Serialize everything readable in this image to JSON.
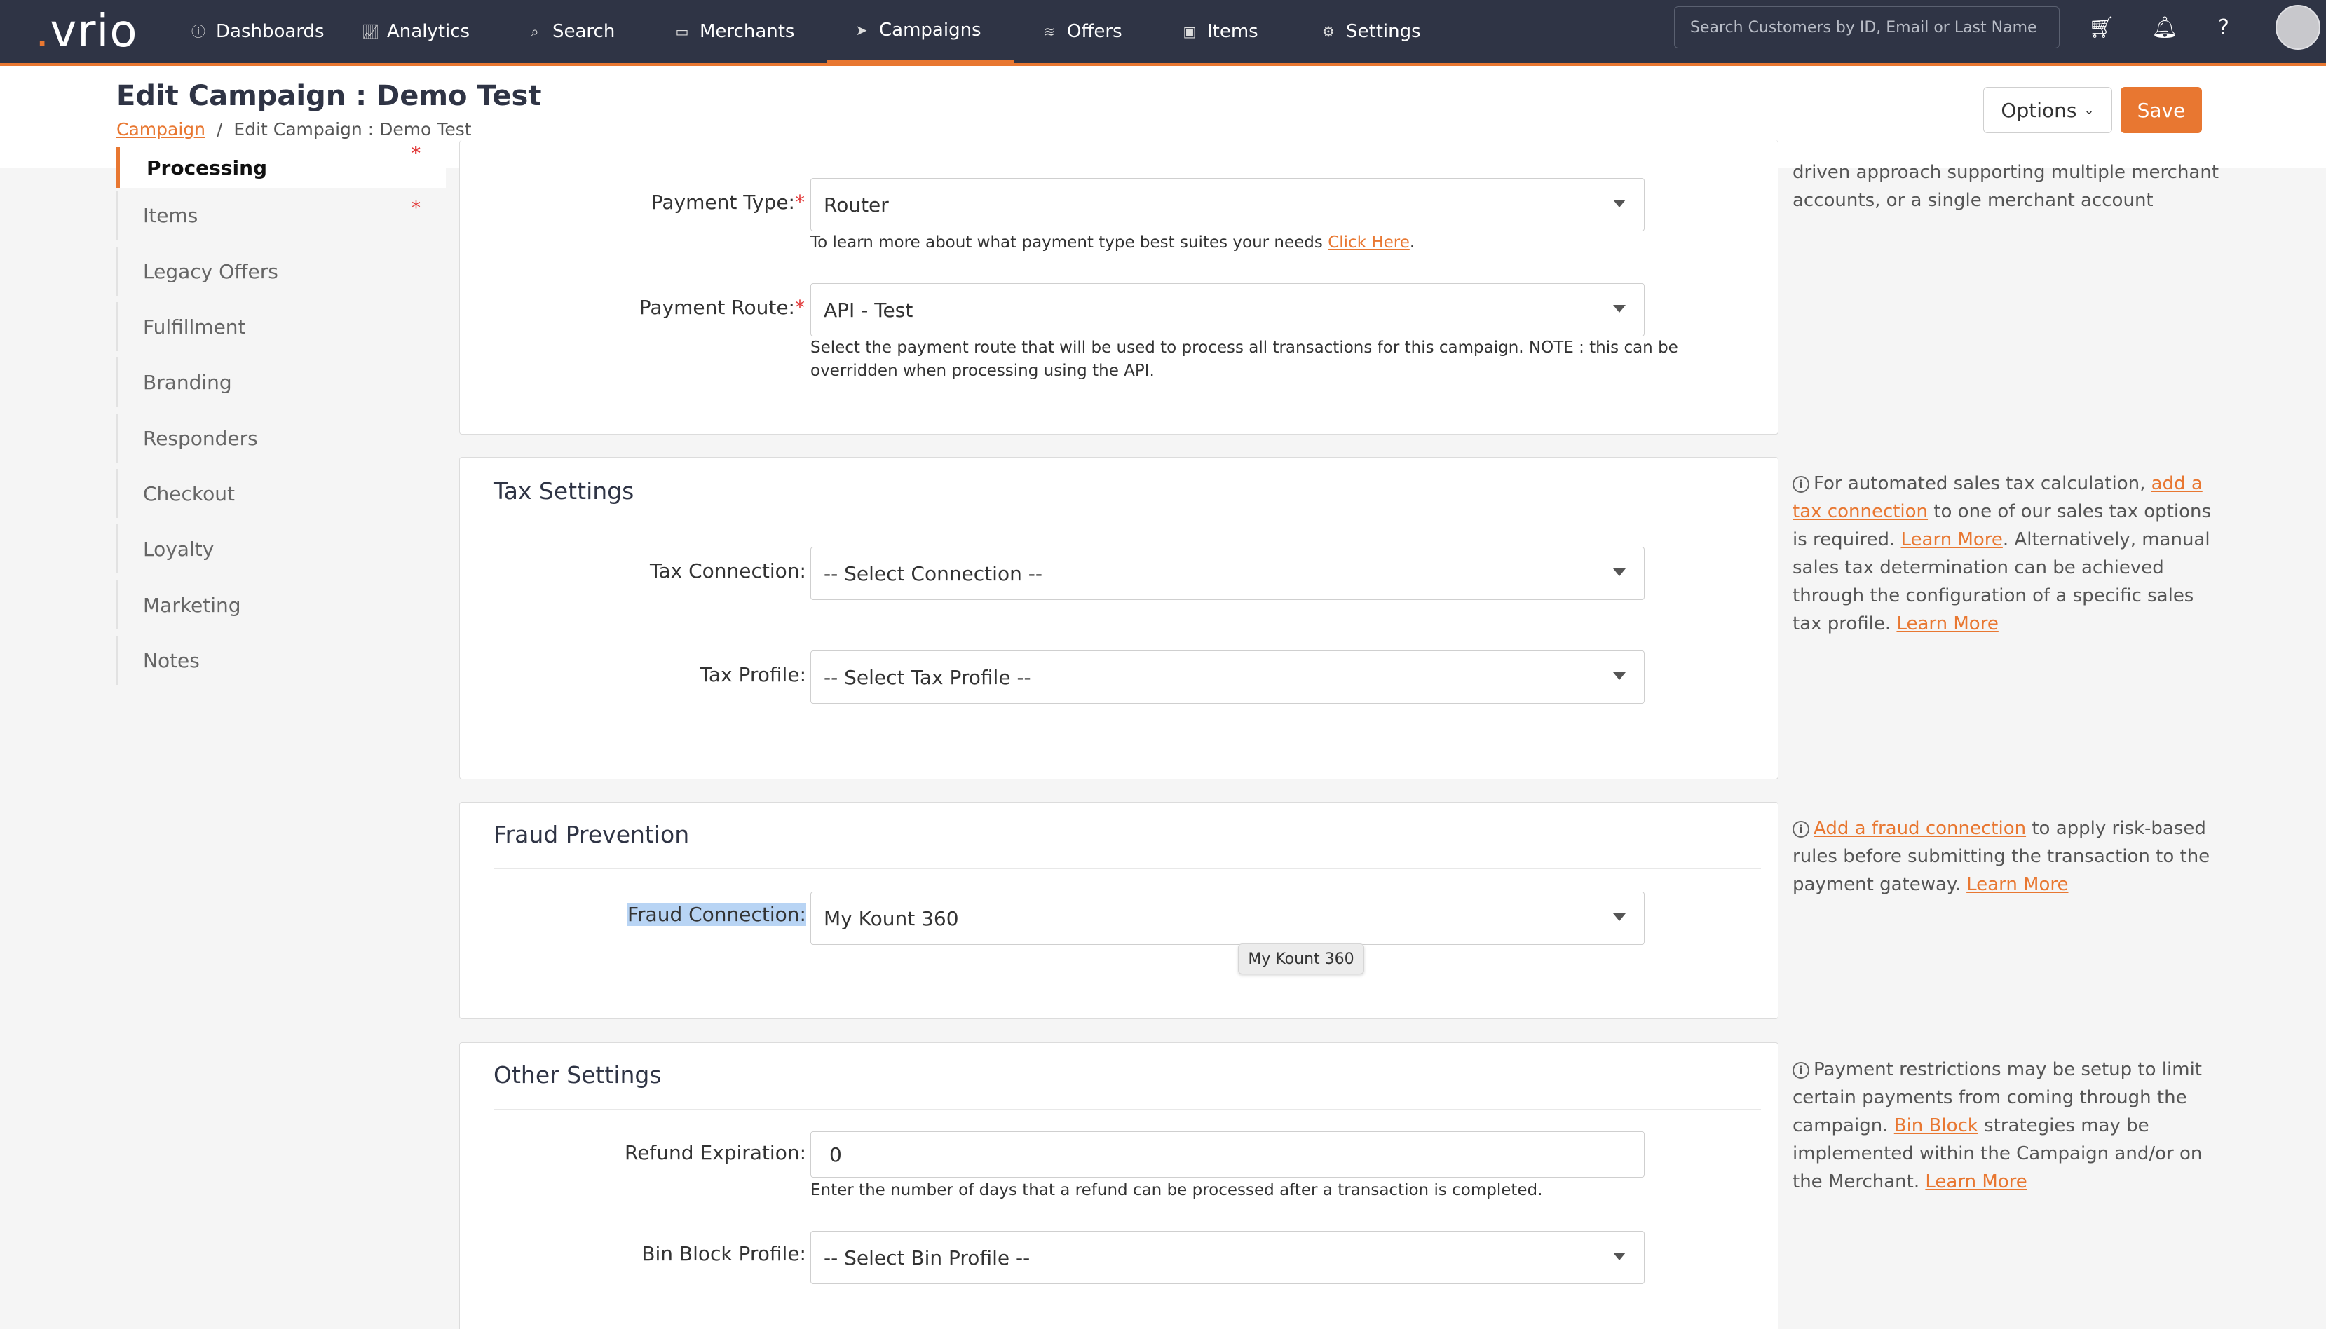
{
  "brand": {
    "logo": "vrio",
    "accent": "#e87731",
    "nav_bg": "#2f3445"
  },
  "nav": {
    "items": [
      {
        "label": "Dashboards",
        "icon": "info-circle-icon"
      },
      {
        "label": "Analytics",
        "icon": "chart-line-icon"
      },
      {
        "label": "Search",
        "icon": "search-icon"
      },
      {
        "label": "Merchants",
        "icon": "credit-card-icon"
      },
      {
        "label": "Campaigns",
        "icon": "paper-plane-icon",
        "active": true
      },
      {
        "label": "Offers",
        "icon": "layers-icon"
      },
      {
        "label": "Items",
        "icon": "box-icon"
      },
      {
        "label": "Settings",
        "icon": "gears-icon"
      }
    ],
    "search_placeholder": "Search Customers by ID, Email or Last Name"
  },
  "header": {
    "title": "Edit Campaign : Demo Test",
    "breadcrumb": {
      "link": "Campaign",
      "current": "Edit Campaign : Demo Test"
    },
    "options_label": "Options",
    "save_label": "Save"
  },
  "sidebar": {
    "items": [
      {
        "label": "Processing",
        "active": true,
        "required": true
      },
      {
        "label": "Items",
        "required": true
      },
      {
        "label": "Legacy Offers"
      },
      {
        "label": "Fulfillment"
      },
      {
        "label": "Branding"
      },
      {
        "label": "Responders"
      },
      {
        "label": "Checkout"
      },
      {
        "label": "Loyalty"
      },
      {
        "label": "Marketing"
      },
      {
        "label": "Notes"
      }
    ]
  },
  "processing": {
    "payment_type_label": "Payment Type:",
    "payment_type_value": "Router",
    "payment_type_help": "To learn more about what payment type best suites your needs ",
    "payment_type_help_link": "Click Here",
    "payment_route_label": "Payment Route:",
    "payment_route_value": "API - Test",
    "payment_route_help": "Select the payment route that will be used to process all transactions for this campaign. NOTE : this can be overridden when processing using the API.",
    "info_text": "driven approach supporting multiple merchant accounts, or a single merchant account option."
  },
  "tax": {
    "title": "Tax Settings",
    "connection_label": "Tax Connection:",
    "connection_value": "-- Select Connection --",
    "profile_label": "Tax Profile:",
    "profile_value": "-- Select Tax Profile --",
    "info_1": "For automated sales tax calculation, ",
    "info_link_1": "add a tax connection",
    "info_2": " to one of our sales tax options is required. ",
    "info_link_2": "Learn More",
    "info_3": ". Alternatively, manual sales tax determination can be achieved through the configuration of a specific sales tax profile. ",
    "info_link_3": "Learn More"
  },
  "fraud": {
    "title": "Fraud Prevention",
    "connection_label": "Fraud Connection:",
    "connection_value": "My Kount 360",
    "tooltip": "My Kount 360",
    "info_link_1": "Add a fraud connection",
    "info_1": " to apply risk-based rules before submitting the transaction to the payment gateway. ",
    "info_link_2": "Learn More"
  },
  "other": {
    "title": "Other Settings",
    "refund_label": "Refund Expiration:",
    "refund_value": "0",
    "refund_help": "Enter the number of days that a refund can be processed after a transaction is completed.",
    "bin_label": "Bin Block Profile:",
    "bin_value": "-- Select Bin Profile --",
    "info_1": "Payment restrictions may be setup to limit certain payments from coming through the campaign. ",
    "info_link_1": "Bin Block",
    "info_2": " strategies may be implemented within the Campaign and/or on the Merchant. ",
    "info_link_2": "Learn More"
  }
}
